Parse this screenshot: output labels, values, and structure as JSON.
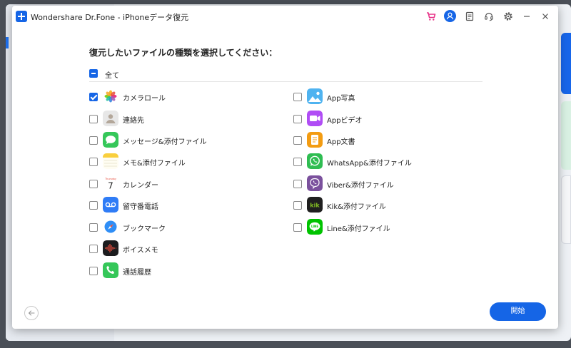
{
  "window": {
    "title": "Wondershare Dr.Fone - iPhoneデータ復元"
  },
  "titlebar_icons": [
    "cart-icon",
    "avatar-icon",
    "notes-icon",
    "headset-icon",
    "gear-icon",
    "minimize-icon",
    "close-icon"
  ],
  "heading": "復元したいファイルの種類を選択してください：",
  "select_all": {
    "label": "全て",
    "state": "indeterminate"
  },
  "left_items": [
    {
      "label": "カメラロール",
      "icon": "photos-icon",
      "checked": true
    },
    {
      "label": "連絡先",
      "icon": "contacts-icon",
      "checked": false
    },
    {
      "label": "メッセージ&添付ファイル",
      "icon": "messages-icon",
      "checked": false
    },
    {
      "label": "メモ&添付ファイル",
      "icon": "notes-app-icon",
      "checked": false
    },
    {
      "label": "カレンダー",
      "icon": "calendar-icon",
      "calendar_day_name": "Thursday",
      "calendar_day": "7",
      "checked": false
    },
    {
      "label": "留守番電話",
      "icon": "voicemail-icon",
      "checked": false
    },
    {
      "label": "ブックマーク",
      "icon": "safari-icon",
      "checked": false
    },
    {
      "label": "ボイスメモ",
      "icon": "voice-memo-icon",
      "checked": false
    },
    {
      "label": "通話履歴",
      "icon": "phone-icon",
      "checked": false
    }
  ],
  "right_items": [
    {
      "label": "App写真",
      "icon": "app-photo-icon",
      "checked": false
    },
    {
      "label": "Appビデオ",
      "icon": "app-video-icon",
      "checked": false
    },
    {
      "label": "App文書",
      "icon": "app-document-icon",
      "checked": false
    },
    {
      "label": "WhatsApp&添付ファイル",
      "icon": "whatsapp-icon",
      "checked": false
    },
    {
      "label": "Viber&添付ファイル",
      "icon": "viber-icon",
      "checked": false
    },
    {
      "label": "Kik&添付ファイル",
      "icon": "kik-icon",
      "kik_text": "kik",
      "checked": false
    },
    {
      "label": "Line&添付ファイル",
      "icon": "line-icon",
      "line_text": "LINE",
      "checked": false
    }
  ],
  "footer": {
    "start_label": "開始"
  },
  "colors": {
    "accent": "#1565e6",
    "cart": "#e8358a"
  }
}
